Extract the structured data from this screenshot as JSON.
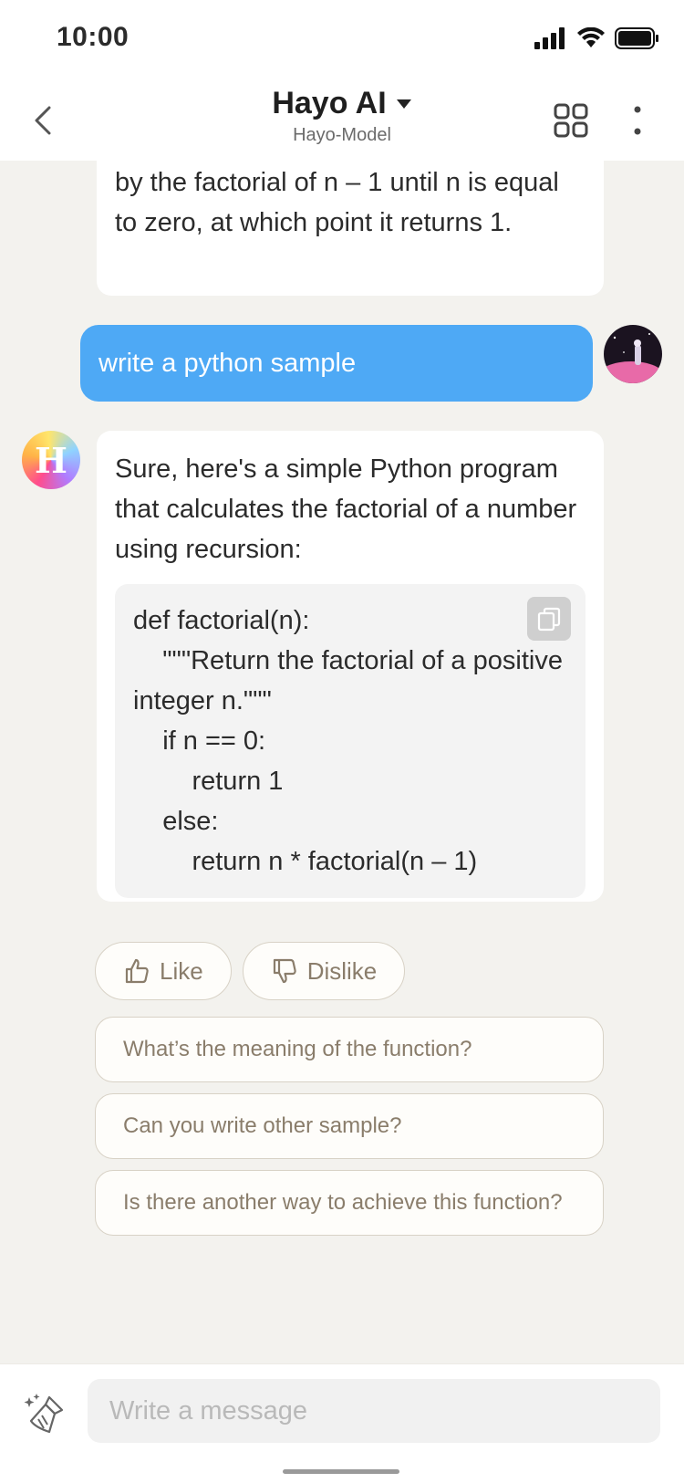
{
  "status_bar": {
    "time": "10:00"
  },
  "header": {
    "title": "Hayo AI",
    "subtitle": "Hayo-Model"
  },
  "messages": {
    "previous_bot_text": "by the factorial of n – 1 until n is equal to zero, at which point it returns 1.",
    "user_text": "write a python sample",
    "bot_avatar_letter": "H",
    "bot_text": "Sure, here's a simple Python program that calculates the factorial of a number using recursion:",
    "code_lines": [
      "def factorial(n):",
      "    \"\"\"Return the factorial of a positive integer n.\"\"\"",
      "    if n == 0:",
      "        return 1",
      "    else:",
      "        return n * factorial(n – 1)"
    ]
  },
  "reactions": {
    "like": "Like",
    "dislike": "Dislike"
  },
  "suggestions": [
    "What’s the meaning of the function?",
    "Can you write other sample?",
    "Is there another way to achieve this function?"
  ],
  "composer": {
    "placeholder": "Write a message"
  },
  "colors": {
    "accent_blue": "#4ea9f5",
    "background": "#f3f2ee",
    "suggestion_text": "#8a7d6b"
  },
  "icons": [
    "back-chevron-icon",
    "dropdown-caret-icon",
    "grid-icon",
    "more-vertical-icon",
    "copy-icon",
    "thumbs-up-icon",
    "thumbs-down-icon",
    "magic-brush-icon",
    "signal-icon",
    "wifi-icon",
    "battery-icon"
  ]
}
